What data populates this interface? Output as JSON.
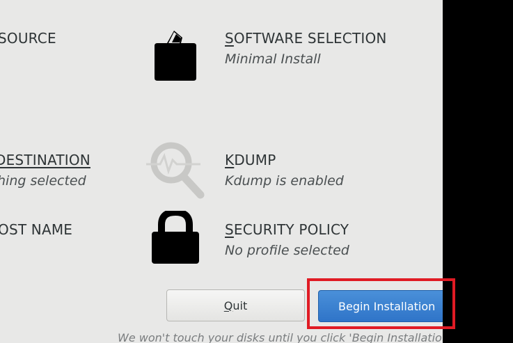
{
  "left_column": {
    "source_title": "SOURCE",
    "destination_title": "DESTINATION",
    "destination_status": "hing selected",
    "hostname_title": "OST NAME"
  },
  "software_selection": {
    "title_mnemonic": "S",
    "title_rest": "OFTWARE SELECTION",
    "status": "Minimal Install",
    "icon": "package-icon"
  },
  "kdump": {
    "title_mnemonic": "K",
    "title_rest": "DUMP",
    "status": "Kdump is enabled",
    "icon": "magnifier-icon"
  },
  "security_policy": {
    "title_mnemonic": "S",
    "title_rest": "ECURITY POLICY",
    "status": "No profile selected",
    "icon": "padlock-icon"
  },
  "buttons": {
    "quit_mnemonic": "Q",
    "quit_rest": "uit",
    "begin_label": "Begin Installation"
  },
  "footer_note": "We won't touch your disks until you click 'Begin Installatio",
  "colors": {
    "accent": "#3584e4",
    "highlight": "#e01b24",
    "background": "#e8e8e7"
  }
}
